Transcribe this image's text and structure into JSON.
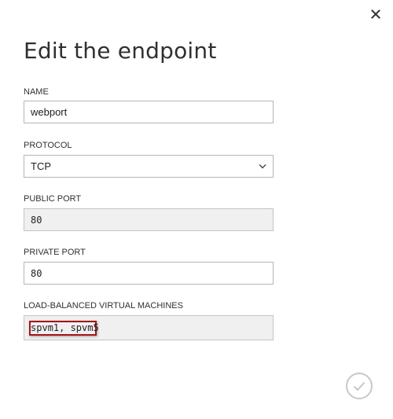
{
  "dialog": {
    "title": "Edit the endpoint"
  },
  "fields": {
    "name": {
      "label": "NAME",
      "value": "webport"
    },
    "protocol": {
      "label": "PROTOCOL",
      "selected": "TCP"
    },
    "public_port": {
      "label": "PUBLIC PORT",
      "value": "80"
    },
    "private_port": {
      "label": "PRIVATE PORT",
      "value": "80"
    },
    "load_balanced": {
      "label": "LOAD-BALANCED VIRTUAL MACHINES",
      "value": "spvm1, spvm5"
    }
  },
  "icons": {
    "close": "close-icon",
    "chevron": "chevron-down-icon",
    "confirm": "checkmark-icon"
  },
  "colors": {
    "border": "#b6b6b6",
    "readonly_bg": "#f0f0f0",
    "highlight": "#a4161a",
    "confirm_ring": "#c8c8c8"
  }
}
